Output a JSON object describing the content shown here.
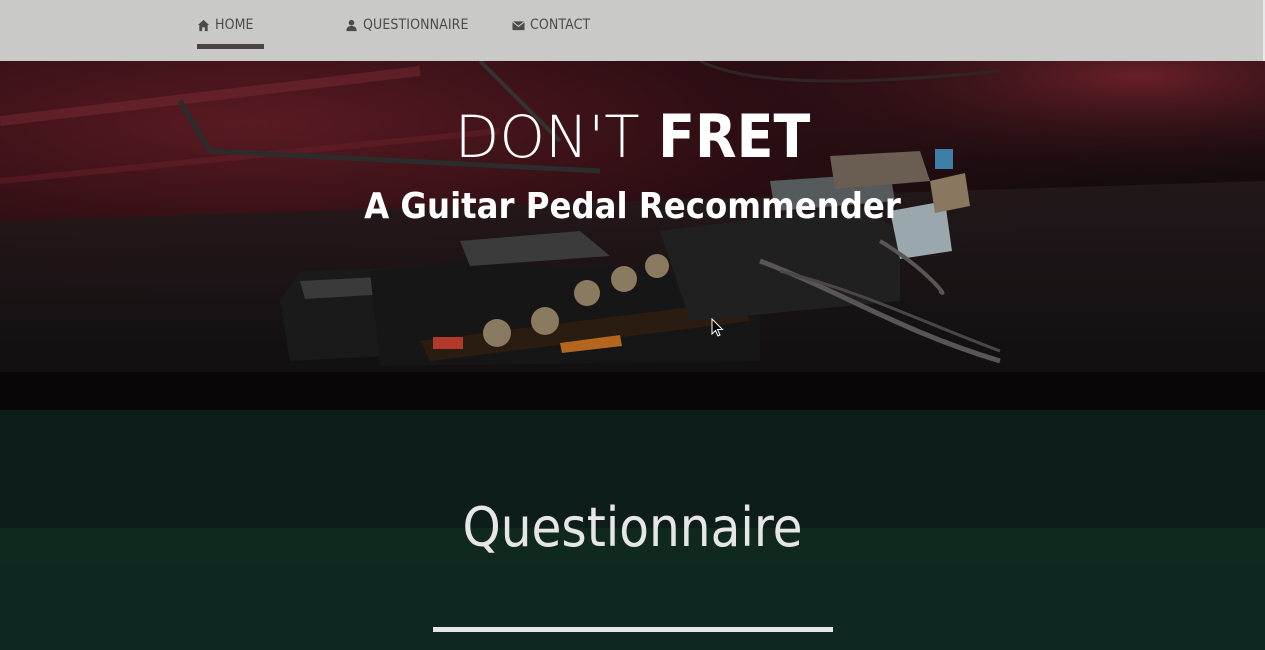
{
  "nav": {
    "items": [
      {
        "label": "HOME",
        "icon": "home-icon",
        "active": true
      },
      {
        "label": "QUESTIONNAIRE",
        "icon": "user-icon",
        "active": false
      },
      {
        "label": "CONTACT",
        "icon": "envelope-icon",
        "active": false
      }
    ]
  },
  "hero": {
    "title_light": "DON'T ",
    "title_bold": "FRET",
    "subtitle": "A Guitar Pedal Recommender"
  },
  "section": {
    "title": "Questionnaire"
  },
  "colors": {
    "nav_bg": "#c9c9c7",
    "nav_text": "#4b4b4b",
    "section_bg": "#0f2723",
    "accent_line": "#e6e6e6"
  }
}
